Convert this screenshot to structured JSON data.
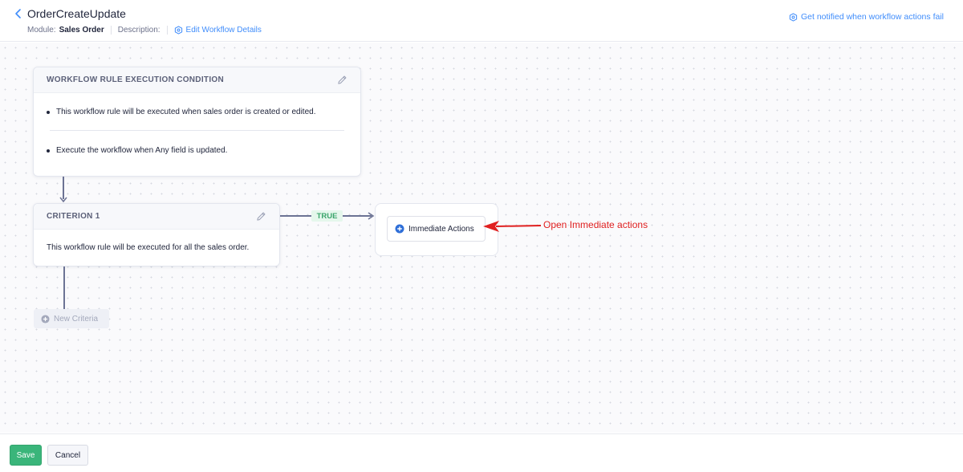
{
  "header": {
    "title": "OrderCreateUpdate",
    "module_label": "Module:",
    "module_value": "Sales Order",
    "description_label": "Description:",
    "edit_details_label": "Edit Workflow Details",
    "notify_label": "Get notified when workflow actions fail"
  },
  "execution_condition": {
    "heading": "WORKFLOW RULE EXECUTION CONDITION",
    "lines": [
      "This workflow rule will be executed when sales order is created or edited.",
      "Execute the workflow when Any field is updated."
    ]
  },
  "criterion": {
    "heading": "CRITERION 1",
    "text": "This workflow rule will be executed for all the sales order."
  },
  "branch": {
    "true_label": "TRUE",
    "immediate_actions_label": "Immediate Actions"
  },
  "new_criteria_label": "New Criteria",
  "annotation": {
    "text": "Open Immediate actions",
    "color": "#e02020"
  },
  "footer": {
    "save_label": "Save",
    "cancel_label": "Cancel"
  },
  "colors": {
    "accent": "#408dfb",
    "save": "#3ab57a",
    "true_badge": "#3aa56b"
  }
}
